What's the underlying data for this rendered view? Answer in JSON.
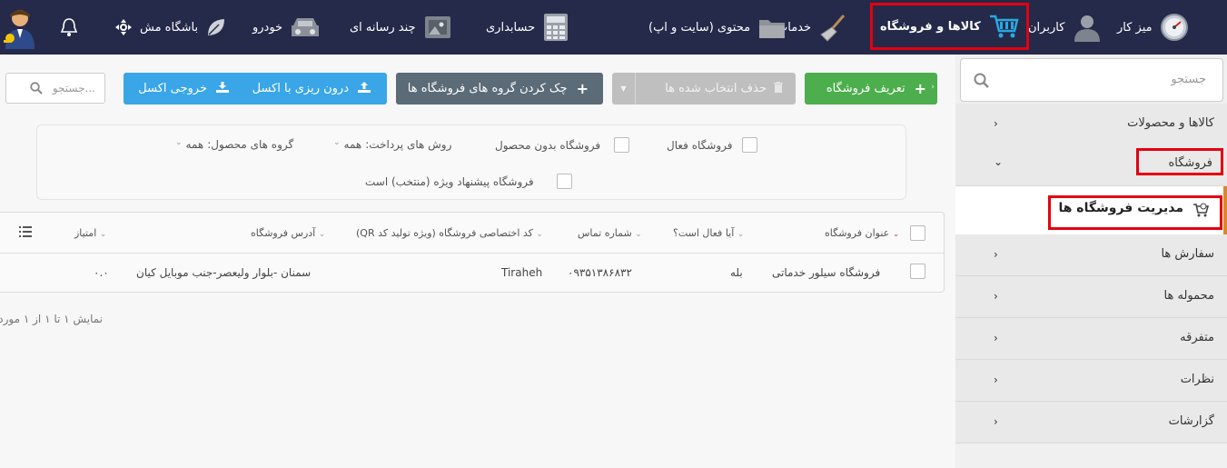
{
  "topnav": {
    "items": [
      {
        "label": "میز کار",
        "icon": "speedometer-icon"
      },
      {
        "label": "کاربران",
        "icon": "user-icon"
      },
      {
        "label": "کالاها و فروشگاه",
        "icon": "cart-icon"
      },
      {
        "label": "خدمات",
        "icon": "broom-icon"
      },
      {
        "label": "محتوی (سایت و اپ)",
        "icon": "folder-icon"
      },
      {
        "label": "حسابداری",
        "icon": "calculator-icon"
      },
      {
        "label": "چند رسانه ای",
        "icon": "media-icon"
      },
      {
        "label": "خودرو",
        "icon": "car-icon"
      },
      {
        "label": "باشگاه مش",
        "icon": "leaf-icon"
      }
    ],
    "colors": {
      "bar": "#252a4a",
      "highlight": "#e3000f"
    }
  },
  "sidebar": {
    "search_placeholder": "جستجو",
    "items": [
      {
        "label": "کالاها و محصولات",
        "chevron": "›"
      },
      {
        "label": "فروشگاه",
        "chevron": "⌄"
      },
      {
        "label": "سفارش ها",
        "chevron": "›"
      },
      {
        "label": "محموله ها",
        "chevron": "›"
      },
      {
        "label": "متفرقه",
        "chevron": "›"
      },
      {
        "label": "نظرات",
        "chevron": "›"
      },
      {
        "label": "گزارشات",
        "chevron": "›"
      }
    ],
    "sub_item": {
      "label": "مدیریت فروشگاه ها",
      "icon": "shop-cart-icon"
    },
    "accent": "#d9882a"
  },
  "toolbar": {
    "define_store": "تعریف فروشگاه",
    "delete_selected": "حذف انتخاب شده ها",
    "check_groups": "چک کردن گروه های فروشگاه ها",
    "import_excel": "درون ریزی با اکسل",
    "export_excel": "خروجی اکسل",
    "search_placeholder": "جستجو...",
    "colors": {
      "green": "#4cae4c",
      "gray": "#bfbfbf",
      "slate": "#5b6b78",
      "blue": "#3aa6e8"
    }
  },
  "filters": {
    "active_store": "فروشگاه فعال",
    "store_without_product": "فروشگاه بدون محصول",
    "payment_methods_label": "روش های پرداخت:",
    "payment_methods_value": "همه",
    "product_groups_label": "گروه های محصول:",
    "product_groups_value": "همه",
    "special_offer": "فروشگاه پیشنهاد ویژه (منتخب) است"
  },
  "table": {
    "headers": {
      "title": "عنوان فروشگاه",
      "active": "آیا فعال است؟",
      "phone": "شماره تماس",
      "code": "کد اختصاصی فروشگاه (ویژه تولید کد QR)",
      "address": "آدرس فروشگاه",
      "score": "امتیاز"
    },
    "rows": [
      {
        "title": "فروشگاه سیلور خدماتی",
        "active": "بله",
        "phone": "۰۹۳۵۱۳۸۶۸۳۲",
        "code": "Tiraheh",
        "address": "سمنان -بلوار ولیعصر-جنب موبایل کیان",
        "score": "۰.۰"
      }
    ]
  },
  "summary": "نمایش ۱ تا ۱ از ۱ مورد"
}
